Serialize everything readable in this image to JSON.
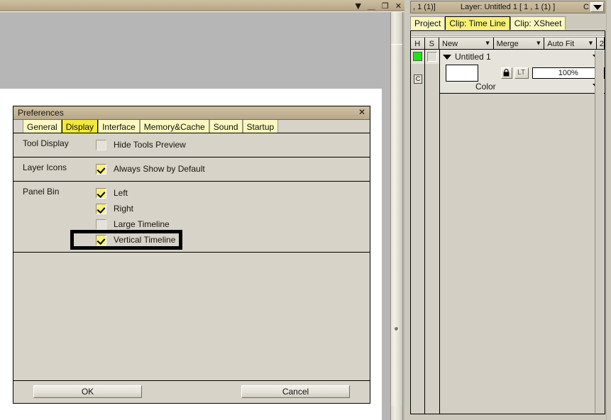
{
  "app_window": {
    "titlebar_buttons": [
      {
        "name": "menu-caret",
        "glyph": "▼"
      },
      {
        "name": "minimize",
        "glyph": "＿"
      },
      {
        "name": "restore",
        "glyph": "❐"
      },
      {
        "name": "close",
        "glyph": "✕"
      }
    ]
  },
  "preferences": {
    "title": "Preferences",
    "close_glyph": "✕",
    "tabs": [
      {
        "label": "General",
        "active": false
      },
      {
        "label": "Display",
        "active": true
      },
      {
        "label": "Interface",
        "active": false
      },
      {
        "label": "Memory&Cache",
        "active": false
      },
      {
        "label": "Sound",
        "active": false
      },
      {
        "label": "Startup",
        "active": false
      }
    ],
    "rows": [
      {
        "label": "Tool Display",
        "options": [
          {
            "label": "Hide Tools Preview",
            "checked": false,
            "highlighted": false
          }
        ]
      },
      {
        "label": "Layer Icons",
        "options": [
          {
            "label": "Always Show by Default",
            "checked": true,
            "highlighted": false
          }
        ]
      },
      {
        "label": "Panel Bin",
        "options": [
          {
            "label": "Left",
            "checked": true,
            "highlighted": false
          },
          {
            "label": "Right",
            "checked": true,
            "highlighted": false
          },
          {
            "label": "Large Timeline",
            "checked": false,
            "highlighted": false
          },
          {
            "label": "Vertical Timeline",
            "checked": true,
            "highlighted": true
          }
        ]
      }
    ],
    "buttons": {
      "ok": "OK",
      "cancel": "Cancel"
    }
  },
  "right_panel": {
    "titlebar": {
      "left_text": ", 1 (1)]",
      "center_text": "Layer: Untitled 1 [ 1 , 1  (1) ]",
      "right_text": "C",
      "dropdown_glyph": "▼"
    },
    "tabs": [
      {
        "label": "Project",
        "active": false
      },
      {
        "label": "Clip: Time Line",
        "active": true
      },
      {
        "label": "Clip: XSheet",
        "active": false
      }
    ],
    "columns": [
      {
        "label": "H",
        "dropdown": false
      },
      {
        "label": "S",
        "dropdown": false
      },
      {
        "label": "New",
        "dropdown": true
      },
      {
        "label": "Merge",
        "dropdown": true
      },
      {
        "label": "Auto Fit",
        "dropdown": true
      },
      {
        "label": "2",
        "dropdown": false
      }
    ],
    "layer": {
      "name": "Untitled 1",
      "h_indicator_color": "#21e21b",
      "c_button_label": "C",
      "s_checked": false,
      "color_swatch": "#ffffff",
      "lock_glyph": "🔒",
      "lt_button_label": "LT",
      "opacity": "100%",
      "blend_mode": "Color"
    }
  }
}
